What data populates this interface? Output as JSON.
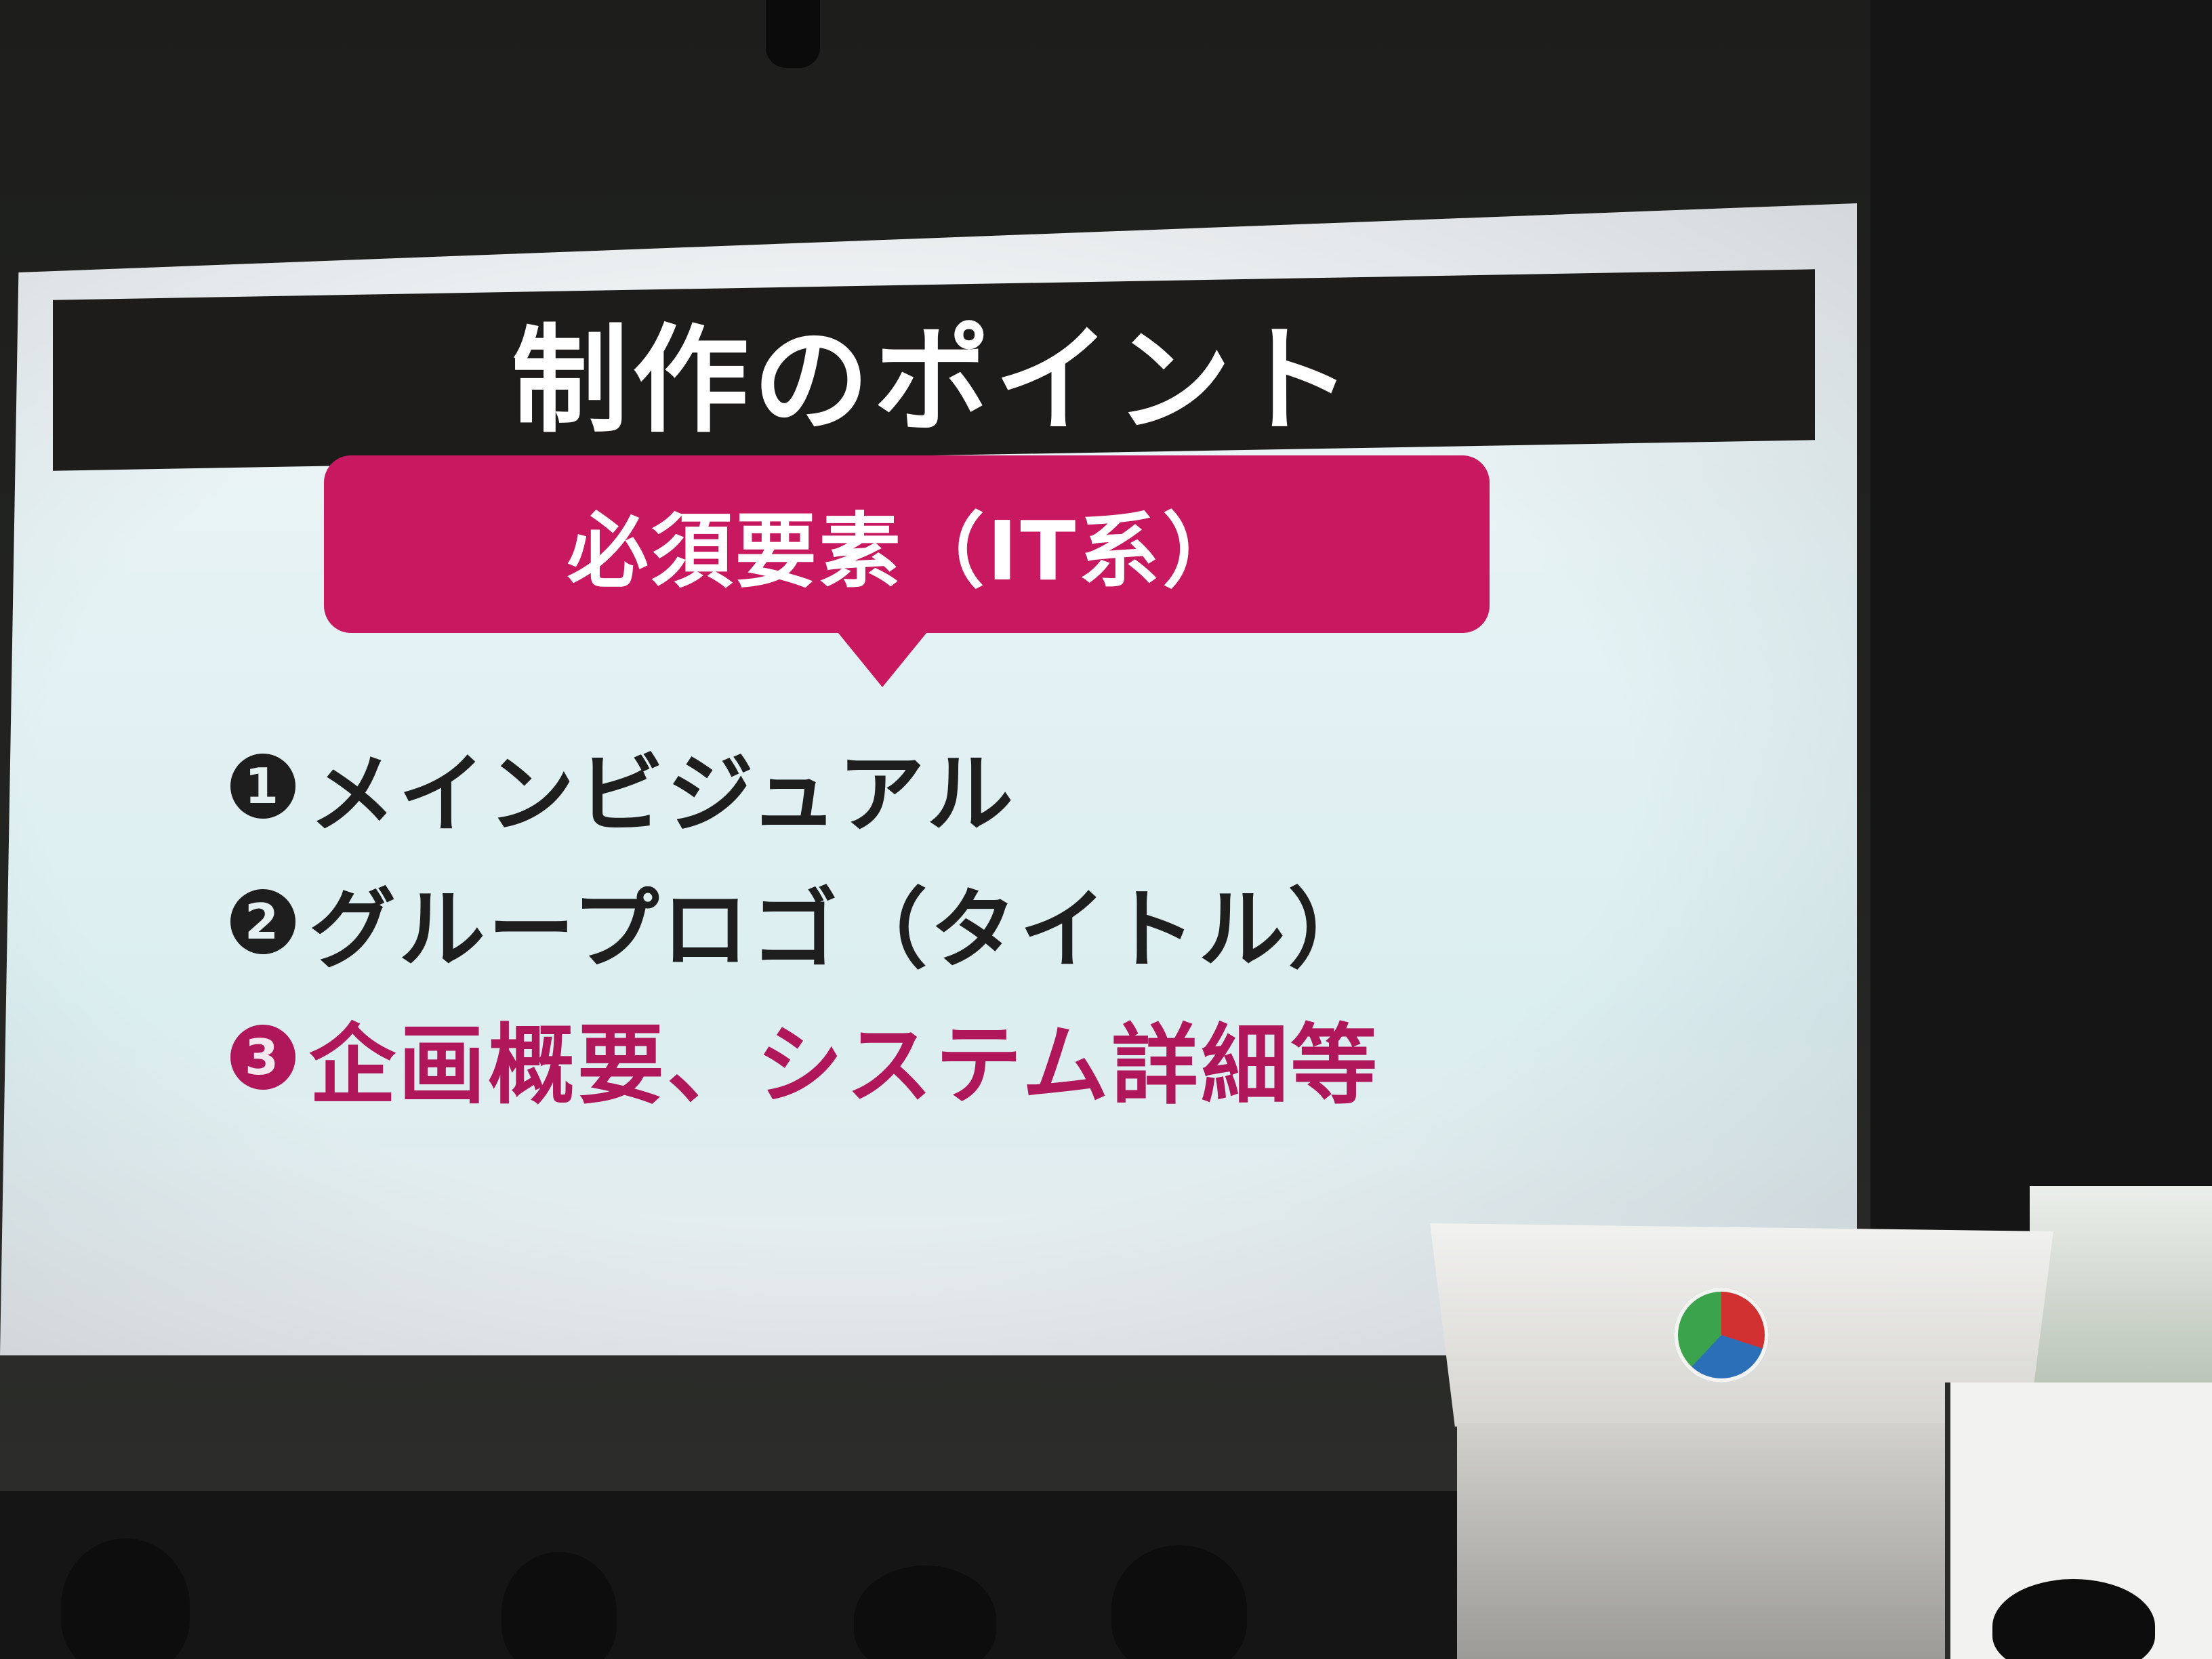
{
  "slide": {
    "title": "制作のポイント",
    "bubble_label": "必須要素（IT系）",
    "points": [
      {
        "number": "1",
        "text": "メインビジュアル",
        "color": "#1f1e1e"
      },
      {
        "number": "2",
        "text": "グループロゴ（タイトル）",
        "color": "#1f1e1e"
      },
      {
        "number": "3",
        "text": "企画概要、システム詳細等",
        "color": "#b0175a"
      }
    ]
  },
  "colors": {
    "title_bar": "#1d1c1b",
    "bubble": "#c8185f",
    "accent_text": "#b0175a",
    "background": "#141514"
  }
}
